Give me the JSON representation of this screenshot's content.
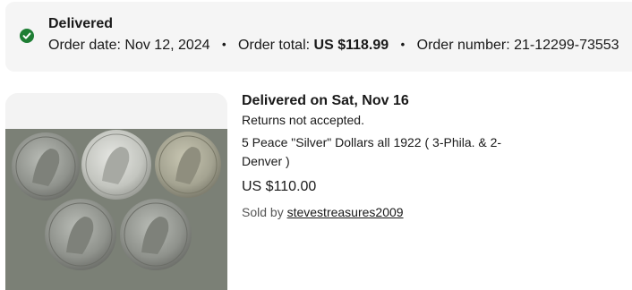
{
  "order": {
    "status": "Delivered",
    "date_label": "Order date:",
    "date_value": "Nov 12, 2024",
    "total_label": "Order total:",
    "total_value": "US $118.99",
    "number_label": "Order number:",
    "number_value": "21-12299-73553",
    "separator": "•"
  },
  "item": {
    "delivery_status": "Delivered on Sat, Nov 16",
    "returns": "Returns not accepted.",
    "title": "5 Peace \"Silver\" Dollars all 1922 ( 3-Phila. & 2-Denver )",
    "price": "US $110.00",
    "sold_by_label": "Sold by",
    "seller": "stevestreasures2009",
    "image_icon": "coins-photo"
  },
  "colors": {
    "banner_bg": "#f5f5f5",
    "success_green": "#1e7e34",
    "text": "#191919"
  }
}
